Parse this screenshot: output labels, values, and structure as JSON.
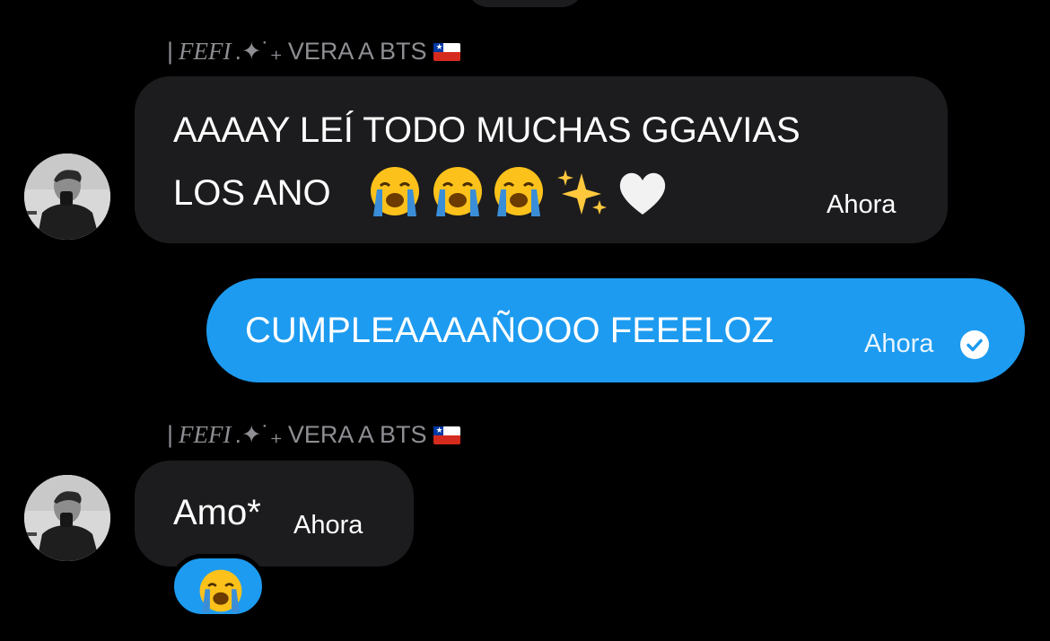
{
  "conversation": {
    "messages": [
      {
        "sender": {
          "bar": "|",
          "name": "FEFI",
          "sparkle": ".✦˙₊",
          "status": "VERA A BTS"
        },
        "direction": "incoming",
        "lines": [
          "AAAAY LEÍ TODO MUCHAS GGAVIAS",
          "LOS ANO"
        ],
        "emoji": [
          "loudly-crying-face",
          "loudly-crying-face",
          "loudly-crying-face",
          "sparkles-emoji",
          "white-heart"
        ],
        "time": "Ahora"
      },
      {
        "direction": "outgoing",
        "text": "CUMPLEAAAAÑOOO FEEELOZ",
        "time": "Ahora",
        "status_icon": "sent-check-icon"
      },
      {
        "sender": {
          "bar": "|",
          "name": "FEFI",
          "sparkle": ".✦˙₊",
          "status": "VERA A BTS"
        },
        "direction": "incoming",
        "text": "Amo*",
        "time": "Ahora",
        "reaction": "loudly-crying-face"
      }
    ]
  },
  "colors": {
    "background": "#000000",
    "incoming_bubble": "#1c1c1e",
    "outgoing_bubble": "#1d9bf0",
    "sender_name": "#8e8e93",
    "tear_blue": "#3a8ed8"
  }
}
